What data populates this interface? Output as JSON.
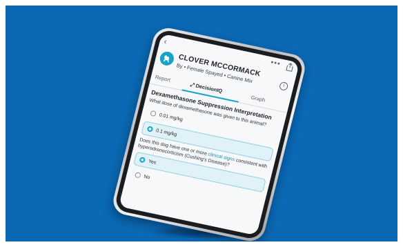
{
  "patient": {
    "name": "CLOVER MCCORMACK",
    "details": "By • Female Spayed • Canine Mix"
  },
  "topbar": {
    "back_icon": "chevron-left-icon",
    "more_label": "•••",
    "share_icon": "share-icon"
  },
  "tabs": [
    {
      "label": "Report"
    },
    {
      "label": "DecisionIQ"
    },
    {
      "label": "Graph"
    }
  ],
  "active_tab": "DecisionIQ",
  "section_title": "Dexamethasone Suppression Interpretation",
  "question1": {
    "text": "What dose of dexamethasone was given to this animal?",
    "options": [
      {
        "label": "0.01 mg/kg",
        "selected": false
      },
      {
        "label": "0.1 mg/kg",
        "selected": true
      }
    ]
  },
  "question2": {
    "text_before": "Does this dog have one or more ",
    "link": "clinical signs",
    "text_after": " consistent with hyperadrenocorticism (Cushing's Disease)?",
    "options": [
      {
        "label": "Yes",
        "selected": true
      },
      {
        "label": "No",
        "selected": false
      }
    ]
  },
  "colors": {
    "background": "#0a68b4",
    "accent": "#17a3c7"
  }
}
